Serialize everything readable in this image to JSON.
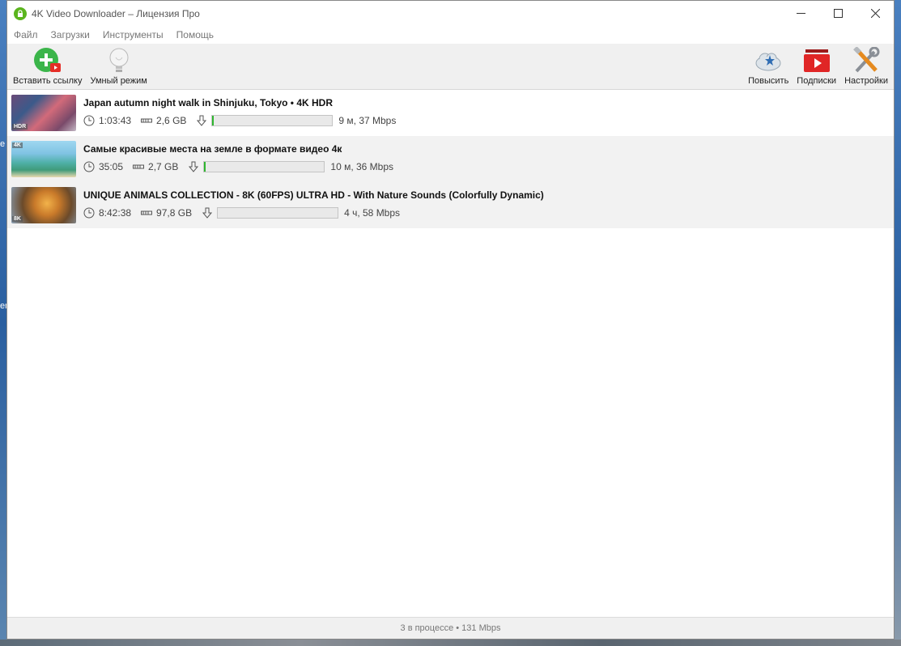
{
  "window": {
    "title": "4K Video Downloader – Лицензия Про"
  },
  "menu": [
    {
      "label": "Файл"
    },
    {
      "label": "Загрузки"
    },
    {
      "label": "Инструменты"
    },
    {
      "label": "Помощь"
    }
  ],
  "toolbar": {
    "paste_label": "Вставить ссылку",
    "smart_label": "Умный режим",
    "upgrade_label": "Повысить",
    "subscriptions_label": "Подписки",
    "settings_label": "Настройки"
  },
  "downloads": [
    {
      "title": "Japan autumn night walk in Shinjuku, Tokyo • 4K HDR",
      "duration": "1:03:43",
      "size": "2,6 GB",
      "progress": 0.01,
      "eta": "9 м, 37 Mbps",
      "badge": "HDR"
    },
    {
      "title": "Самые красивые места на земле в формате видео 4к",
      "duration": "35:05",
      "size": "2,7 GB",
      "progress": 0.01,
      "eta": "10 м, 36 Mbps",
      "badge": "4K"
    },
    {
      "title": "UNIQUE ANIMALS COLLECTION - 8K (60FPS) ULTRA HD - With Nature Sounds (Colorfully Dynamic)",
      "duration": "8:42:38",
      "size": "97,8 GB",
      "progress": 0.0,
      "eta": "4 ч, 58 Mbps",
      "badge": "8K"
    }
  ],
  "status": {
    "text": "3 в процессе • 131 Mbps"
  },
  "colors": {
    "accent_green": "#2fb62f",
    "app_icon": "#5bb51e"
  }
}
